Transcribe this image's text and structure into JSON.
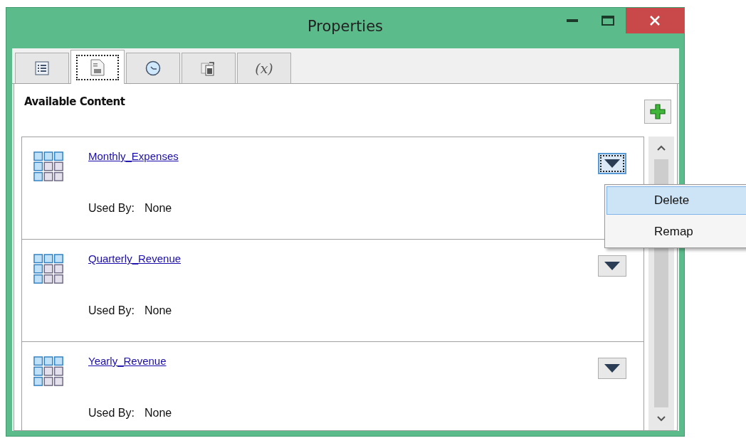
{
  "window": {
    "title": "Properties"
  },
  "tabs": [
    {
      "kind": "list",
      "selected": false
    },
    {
      "kind": "document",
      "selected": true
    },
    {
      "kind": "clock",
      "selected": false
    },
    {
      "kind": "copy",
      "selected": false
    },
    {
      "kind": "variable",
      "label": "(x)",
      "selected": false
    }
  ],
  "section": {
    "title": "Available Content"
  },
  "items": [
    {
      "name": "Monthly_Expenses",
      "used_by_label": "Used By:",
      "used_by": "None",
      "focused": true
    },
    {
      "name": "Quarterly_Revenue",
      "used_by_label": "Used By:",
      "used_by": "None",
      "focused": false
    },
    {
      "name": "Yearly_Revenue",
      "used_by_label": "Used By:",
      "used_by": "None",
      "focused": false
    }
  ],
  "context_menu": {
    "items": [
      {
        "label": "Delete",
        "selected": true
      },
      {
        "label": "Remap",
        "selected": false
      }
    ]
  }
}
